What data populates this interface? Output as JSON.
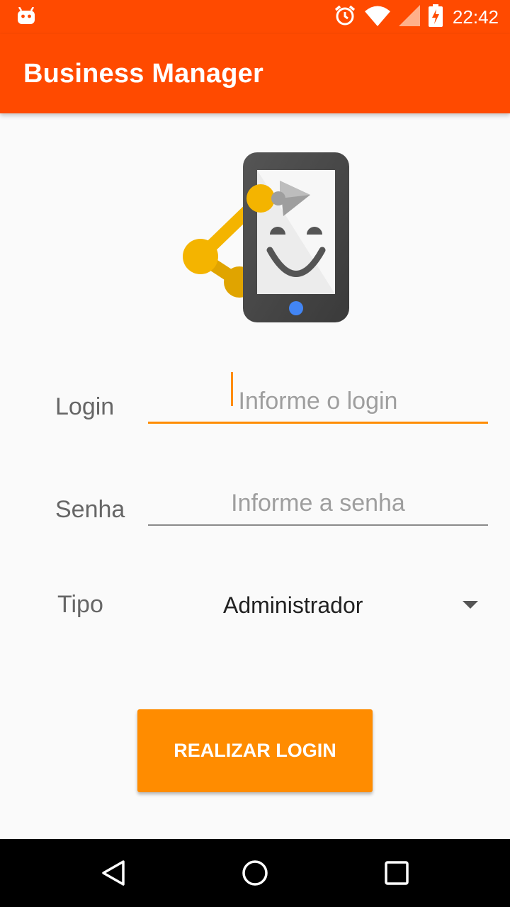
{
  "status_bar": {
    "time": "22:42",
    "icons": [
      "android-debug-icon",
      "alarm-icon",
      "wifi-icon",
      "cell-signal-icon",
      "battery-charging-icon"
    ]
  },
  "app_bar": {
    "title": "Business Manager",
    "color": "#ff4a00"
  },
  "form": {
    "login": {
      "label": "Login",
      "placeholder": "Informe o login",
      "value": ""
    },
    "senha": {
      "label": "Senha",
      "placeholder": "Informe a senha",
      "value": ""
    },
    "tipo": {
      "label": "Tipo",
      "selected": "Administrador"
    },
    "submit_label": "REALIZAR LOGIN",
    "accent_color": "#ff8c00"
  },
  "nav_bar": {
    "buttons": [
      "back-icon",
      "home-icon",
      "recents-icon"
    ]
  }
}
